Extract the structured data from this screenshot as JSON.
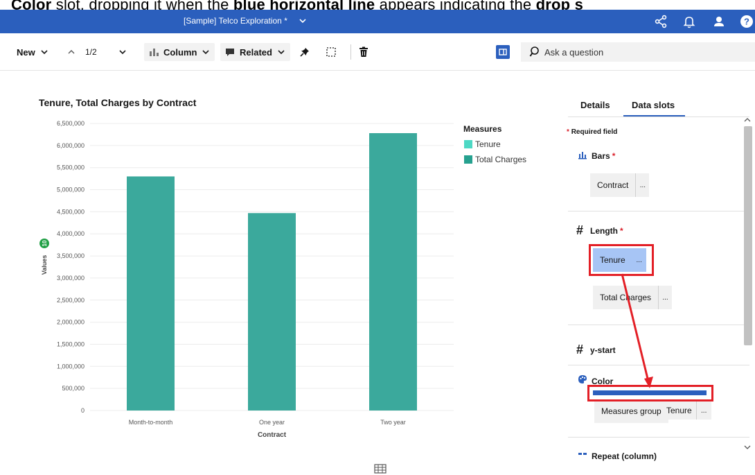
{
  "caption": {
    "pre": "Color",
    "mid1": " slot, dropping it when the ",
    "bold": "blue horizontal line",
    "mid2": " appears indicating the ",
    "tail": "drop s"
  },
  "topbar": {
    "title": "[Sample] Telco Exploration *",
    "color": "#2b5fbd"
  },
  "toolbar": {
    "new_label": "New",
    "page_indicator": "1/2",
    "column_label": "Column",
    "related_label": "Related",
    "ask_placeholder": "Ask a question"
  },
  "chart_data": {
    "type": "bar",
    "title": "Tenure, Total Charges by Contract",
    "xlabel": "Contract",
    "ylabel": "Values",
    "y_badge": "10",
    "categories": [
      "Month-to-month",
      "One year",
      "Two year"
    ],
    "values": [
      5300000,
      4470000,
      6280000
    ],
    "ylim": [
      0,
      6500000
    ],
    "yticks": [
      "0",
      "500,000",
      "1,000,000",
      "1,500,000",
      "2,000,000",
      "2,500,000",
      "3,000,000",
      "3,500,000",
      "4,000,000",
      "4,500,000",
      "5,000,000",
      "5,500,000",
      "6,000,000",
      "6,500,000"
    ],
    "bar_color": "#3ba99c",
    "legend": {
      "title": "Measures",
      "placement": "top-right",
      "items": [
        {
          "name": "Tenure",
          "color": "#4dd8c4"
        },
        {
          "name": "Total Charges",
          "color": "#26a18f"
        }
      ]
    }
  },
  "panel": {
    "tab_details": "Details",
    "tab_data_slots": "Data slots",
    "required_note": "Required field",
    "bars": {
      "title": "Bars",
      "item": "Contract"
    },
    "length": {
      "title": "Length",
      "item1": "Tenure",
      "item2": "Total Charges"
    },
    "ystart": {
      "title": "y-start"
    },
    "color": {
      "title": "Color",
      "item": "Measures group",
      "dragged": "Tenure"
    },
    "repeat": {
      "title": "Repeat (column)"
    },
    "more_glyph": "...",
    "star": "*"
  },
  "colors": {
    "accent": "#2b5fbd",
    "highlight_pill": "#a7c5f5",
    "annotation_red": "#e31f26"
  }
}
